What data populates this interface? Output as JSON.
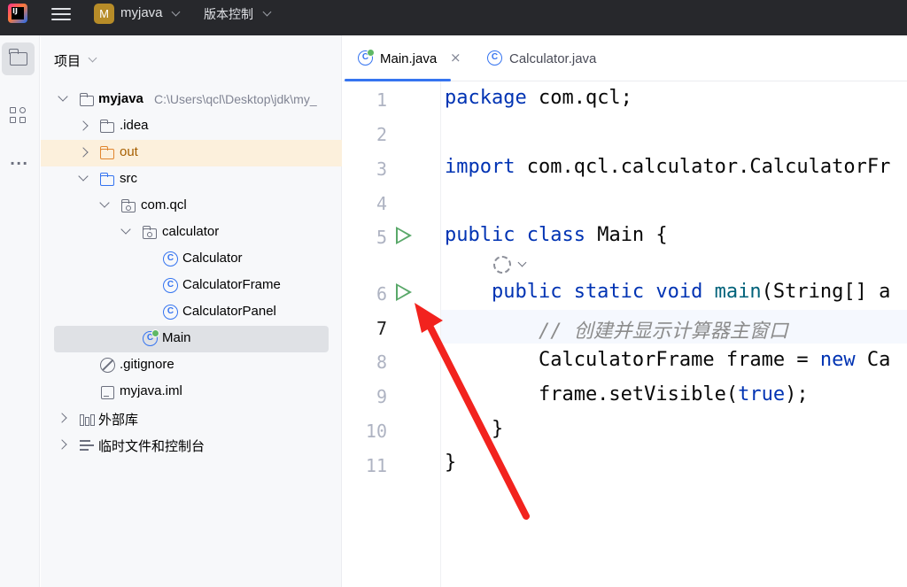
{
  "titlebar": {
    "project_badge": "M",
    "project_name": "myjava",
    "vcs_label": "版本控制"
  },
  "toolstrip": {
    "items": [
      "project-folder-icon",
      "structure-icon",
      "more-icon"
    ]
  },
  "project_panel": {
    "title": "项目",
    "tree": [
      {
        "label": "myjava",
        "path": "C:\\Users\\qcl\\Desktop\\jdk\\my_",
        "icon": "module-folder-icon",
        "expanded": true
      },
      {
        "label": ".idea",
        "icon": "folder-icon",
        "expanded": false
      },
      {
        "label": "out",
        "icon": "excluded-folder-icon",
        "expanded": false
      },
      {
        "label": "src",
        "icon": "source-folder-icon",
        "expanded": true
      },
      {
        "label": "com.qcl",
        "icon": "package-icon",
        "expanded": true
      },
      {
        "label": "calculator",
        "icon": "package-icon",
        "expanded": true
      },
      {
        "label": "Calculator",
        "icon": "class-icon"
      },
      {
        "label": "CalculatorFrame",
        "icon": "class-icon"
      },
      {
        "label": "CalculatorPanel",
        "icon": "class-icon"
      },
      {
        "label": "Main",
        "icon": "runnable-class-icon",
        "selected": true
      },
      {
        "label": ".gitignore",
        "icon": "ignore-file-icon"
      },
      {
        "label": "myjava.iml",
        "icon": "iml-file-icon"
      },
      {
        "label": "外部库",
        "icon": "library-icon",
        "expanded": false
      },
      {
        "label": "临时文件和控制台",
        "icon": "scratch-icon",
        "expanded": false
      }
    ]
  },
  "editor": {
    "tabs": [
      {
        "label": "Main.java",
        "active": true,
        "close": "×"
      },
      {
        "label": "Calculator.java",
        "active": false
      }
    ],
    "lines": [
      "1",
      "2",
      "3",
      "4",
      "5",
      "6",
      "7",
      "8",
      "9",
      "10",
      "11"
    ],
    "current_line": "7",
    "code": {
      "l1_kw": "package",
      "l1_rest": " com.qcl;",
      "l3_kw": "import",
      "l3_rest": " com.qcl.calculator.CalculatorFr",
      "l5_kw": "public class",
      "l5_rest": " Main {",
      "l6_kw": "    public static void",
      "l6_fn": " main",
      "l6_rest": "(String[] a",
      "l7_comment": "        // 创建并显示计算器主窗口",
      "l8_rest": "        CalculatorFrame frame = ",
      "l8_kw": "new",
      "l8_tail": " Ca",
      "l9_rest": "        frame.setVisible(",
      "l9_kw": "true",
      "l9_tail": ");",
      "l10": "    }",
      "l11": "}"
    }
  },
  "colors": {
    "titlebar_bg": "#27282c",
    "accent": "#3574f0",
    "run_green": "#59a869",
    "annotation_red": "#f2231e",
    "keyword": "#0033b3"
  }
}
